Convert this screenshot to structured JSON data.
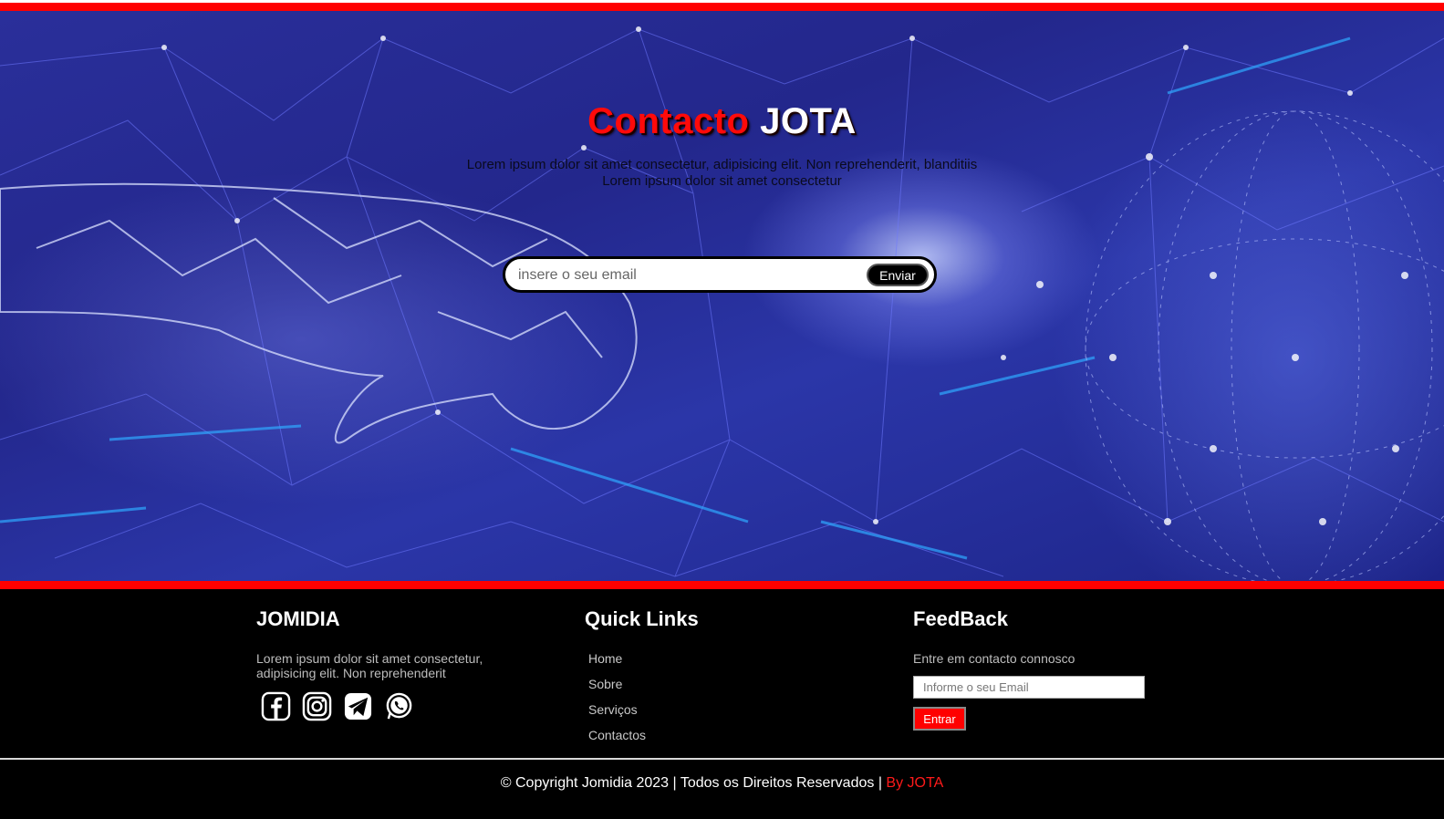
{
  "hero": {
    "title_red": "Contacto",
    "title_white": "JOTA",
    "subtitle_line1": "Lorem ipsum dolor sit amet consectetur, adipisicing elit. Non reprehenderit, blanditiis",
    "subtitle_line2": "Lorem ipsum dolor sit amet consectetur",
    "email_placeholder": "insere o seu email",
    "submit_label": "Enviar"
  },
  "footer": {
    "brand": {
      "title": "JOMIDIA",
      "text": "Lorem ipsum dolor sit amet consectetur, adipisicing elit. Non reprehenderit",
      "socials": [
        "facebook-icon",
        "instagram-icon",
        "telegram-icon",
        "whatsapp-icon"
      ]
    },
    "quick_links": {
      "title": "Quick Links",
      "items": [
        "Home",
        "Sobre",
        "Serviços",
        "Contactos"
      ]
    },
    "feedback": {
      "title": "FeedBack",
      "text": "Entre em contacto connosco",
      "email_placeholder": "Informe o seu Email",
      "button_label": "Entrar"
    },
    "copyright": "© Copyright Jomidia 2023 | Todos os Direitos Reservados | ",
    "by": "By JOTA"
  },
  "colors": {
    "accent": "#ff0000",
    "footer_bg": "#000000",
    "hero_bg": "#23278c"
  }
}
